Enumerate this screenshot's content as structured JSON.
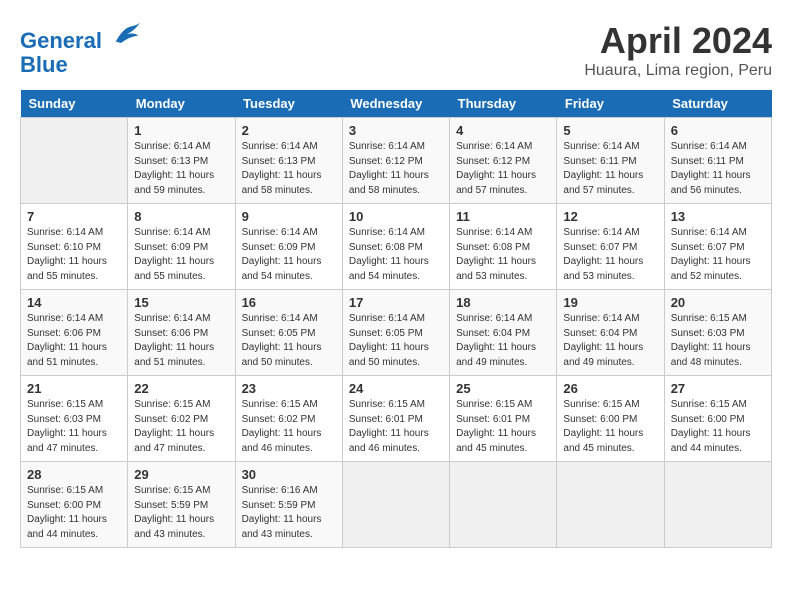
{
  "header": {
    "logo_line1": "General",
    "logo_line2": "Blue",
    "month_title": "April 2024",
    "subtitle": "Huaura, Lima region, Peru"
  },
  "weekdays": [
    "Sunday",
    "Monday",
    "Tuesday",
    "Wednesday",
    "Thursday",
    "Friday",
    "Saturday"
  ],
  "weeks": [
    [
      {
        "day": "",
        "info": ""
      },
      {
        "day": "1",
        "info": "Sunrise: 6:14 AM\nSunset: 6:13 PM\nDaylight: 11 hours\nand 59 minutes."
      },
      {
        "day": "2",
        "info": "Sunrise: 6:14 AM\nSunset: 6:13 PM\nDaylight: 11 hours\nand 58 minutes."
      },
      {
        "day": "3",
        "info": "Sunrise: 6:14 AM\nSunset: 6:12 PM\nDaylight: 11 hours\nand 58 minutes."
      },
      {
        "day": "4",
        "info": "Sunrise: 6:14 AM\nSunset: 6:12 PM\nDaylight: 11 hours\nand 57 minutes."
      },
      {
        "day": "5",
        "info": "Sunrise: 6:14 AM\nSunset: 6:11 PM\nDaylight: 11 hours\nand 57 minutes."
      },
      {
        "day": "6",
        "info": "Sunrise: 6:14 AM\nSunset: 6:11 PM\nDaylight: 11 hours\nand 56 minutes."
      }
    ],
    [
      {
        "day": "7",
        "info": "Sunrise: 6:14 AM\nSunset: 6:10 PM\nDaylight: 11 hours\nand 55 minutes."
      },
      {
        "day": "8",
        "info": "Sunrise: 6:14 AM\nSunset: 6:09 PM\nDaylight: 11 hours\nand 55 minutes."
      },
      {
        "day": "9",
        "info": "Sunrise: 6:14 AM\nSunset: 6:09 PM\nDaylight: 11 hours\nand 54 minutes."
      },
      {
        "day": "10",
        "info": "Sunrise: 6:14 AM\nSunset: 6:08 PM\nDaylight: 11 hours\nand 54 minutes."
      },
      {
        "day": "11",
        "info": "Sunrise: 6:14 AM\nSunset: 6:08 PM\nDaylight: 11 hours\nand 53 minutes."
      },
      {
        "day": "12",
        "info": "Sunrise: 6:14 AM\nSunset: 6:07 PM\nDaylight: 11 hours\nand 53 minutes."
      },
      {
        "day": "13",
        "info": "Sunrise: 6:14 AM\nSunset: 6:07 PM\nDaylight: 11 hours\nand 52 minutes."
      }
    ],
    [
      {
        "day": "14",
        "info": "Sunrise: 6:14 AM\nSunset: 6:06 PM\nDaylight: 11 hours\nand 51 minutes."
      },
      {
        "day": "15",
        "info": "Sunrise: 6:14 AM\nSunset: 6:06 PM\nDaylight: 11 hours\nand 51 minutes."
      },
      {
        "day": "16",
        "info": "Sunrise: 6:14 AM\nSunset: 6:05 PM\nDaylight: 11 hours\nand 50 minutes."
      },
      {
        "day": "17",
        "info": "Sunrise: 6:14 AM\nSunset: 6:05 PM\nDaylight: 11 hours\nand 50 minutes."
      },
      {
        "day": "18",
        "info": "Sunrise: 6:14 AM\nSunset: 6:04 PM\nDaylight: 11 hours\nand 49 minutes."
      },
      {
        "day": "19",
        "info": "Sunrise: 6:14 AM\nSunset: 6:04 PM\nDaylight: 11 hours\nand 49 minutes."
      },
      {
        "day": "20",
        "info": "Sunrise: 6:15 AM\nSunset: 6:03 PM\nDaylight: 11 hours\nand 48 minutes."
      }
    ],
    [
      {
        "day": "21",
        "info": "Sunrise: 6:15 AM\nSunset: 6:03 PM\nDaylight: 11 hours\nand 47 minutes."
      },
      {
        "day": "22",
        "info": "Sunrise: 6:15 AM\nSunset: 6:02 PM\nDaylight: 11 hours\nand 47 minutes."
      },
      {
        "day": "23",
        "info": "Sunrise: 6:15 AM\nSunset: 6:02 PM\nDaylight: 11 hours\nand 46 minutes."
      },
      {
        "day": "24",
        "info": "Sunrise: 6:15 AM\nSunset: 6:01 PM\nDaylight: 11 hours\nand 46 minutes."
      },
      {
        "day": "25",
        "info": "Sunrise: 6:15 AM\nSunset: 6:01 PM\nDaylight: 11 hours\nand 45 minutes."
      },
      {
        "day": "26",
        "info": "Sunrise: 6:15 AM\nSunset: 6:00 PM\nDaylight: 11 hours\nand 45 minutes."
      },
      {
        "day": "27",
        "info": "Sunrise: 6:15 AM\nSunset: 6:00 PM\nDaylight: 11 hours\nand 44 minutes."
      }
    ],
    [
      {
        "day": "28",
        "info": "Sunrise: 6:15 AM\nSunset: 6:00 PM\nDaylight: 11 hours\nand 44 minutes."
      },
      {
        "day": "29",
        "info": "Sunrise: 6:15 AM\nSunset: 5:59 PM\nDaylight: 11 hours\nand 43 minutes."
      },
      {
        "day": "30",
        "info": "Sunrise: 6:16 AM\nSunset: 5:59 PM\nDaylight: 11 hours\nand 43 minutes."
      },
      {
        "day": "",
        "info": ""
      },
      {
        "day": "",
        "info": ""
      },
      {
        "day": "",
        "info": ""
      },
      {
        "day": "",
        "info": ""
      }
    ]
  ]
}
